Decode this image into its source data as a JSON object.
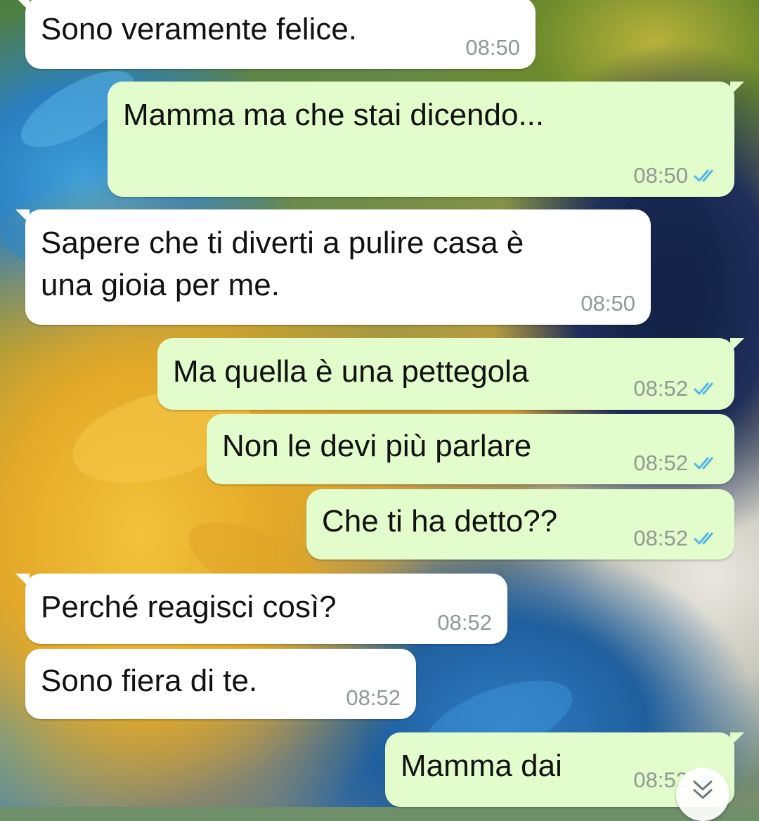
{
  "chat": {
    "messages": [
      {
        "direction": "incoming",
        "text": "Sono veramente felice.",
        "time": "08:50"
      },
      {
        "direction": "outgoing",
        "text": "Mamma ma che stai dicendo...",
        "time": "08:50",
        "status": "read"
      },
      {
        "direction": "incoming",
        "text": "Sapere che ti diverti a pulire casa è\nuna gioia per me.",
        "time": "08:50"
      },
      {
        "direction": "outgoing",
        "text": "Ma quella è una pettegola",
        "time": "08:52",
        "status": "read"
      },
      {
        "direction": "outgoing",
        "text": "Non le devi più parlare",
        "time": "08:52",
        "status": "read"
      },
      {
        "direction": "outgoing",
        "text": "Che ti ha detto??",
        "time": "08:52",
        "status": "read"
      },
      {
        "direction": "incoming",
        "text": "Perché reagisci così?",
        "time": "08:52"
      },
      {
        "direction": "incoming",
        "text": "Sono fiera di te.",
        "time": "08:52"
      },
      {
        "direction": "outgoing",
        "text": "Mamma dai",
        "time": "08:52",
        "status": "read"
      }
    ]
  },
  "icons": {
    "read_receipt": "double-check-icon",
    "scroll_down": "double-chevron-down-icon"
  },
  "colors": {
    "incoming_bubble": "#ffffff",
    "outgoing_bubble": "#e2fdcb",
    "read_ticks": "#4fb6ec",
    "timestamp": "#8e9a94"
  }
}
